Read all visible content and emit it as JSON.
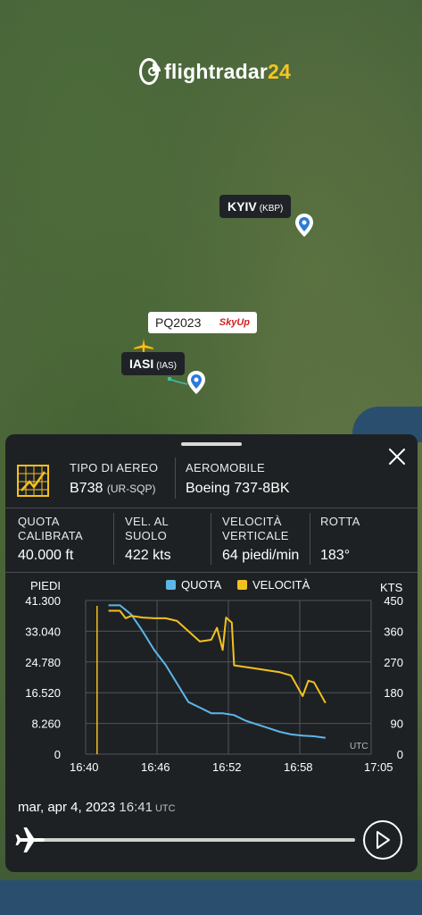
{
  "app": {
    "logo_text": "flightradar",
    "logo_num": "24"
  },
  "map": {
    "kyiv": {
      "name": "KYIV",
      "code": "(KBP)"
    },
    "iasi": {
      "name": "IASI",
      "code": "(IAS)"
    },
    "flight": {
      "callsign": "PQ2023",
      "airline_logo": "SkyUp"
    }
  },
  "panel": {
    "aircraft_type": {
      "label": "TIPO DI AEREO",
      "value": "B738",
      "reg": "(UR-SQP)"
    },
    "aircraft": {
      "label": "AEROMOBILE",
      "value": "Boeing 737-8BK"
    },
    "stats": [
      {
        "label_1": "QUOTA",
        "label_2": "CALIBRATA",
        "value": "40.000 ft"
      },
      {
        "label_1": "VEL. AL",
        "label_2": "SUOLO",
        "value": "422 kts"
      },
      {
        "label_1": "VELOCITÀ",
        "label_2": "VERTICALE",
        "value": "64 piedi/min"
      },
      {
        "label_1": "ROTTA",
        "label_2": "",
        "value": "183°"
      }
    ],
    "footer": {
      "date": "mar, apr 4, 2023",
      "time": "16:41",
      "tz": "UTC"
    }
  },
  "colors": {
    "altitude": "#5db6e8",
    "speed": "#f3c11e",
    "panel_bg": "#1e2124"
  },
  "chart_data": {
    "type": "line",
    "left_axis_label": "PIEDI",
    "right_axis_label": "KTS",
    "x_unit_label": "UTC",
    "x_ticks": [
      "16:40",
      "16:46",
      "16:52",
      "16:58",
      "17:05"
    ],
    "left_ticks": [
      "41.300",
      "33.040",
      "24.780",
      "16.520",
      "8.260",
      "0"
    ],
    "right_ticks": [
      "450",
      "360",
      "270",
      "180",
      "90",
      "0"
    ],
    "left_range": [
      0,
      41300
    ],
    "right_range": [
      0,
      450
    ],
    "legend": [
      {
        "name": "QUOTA",
        "color": "#5db6e8"
      },
      {
        "name": "VELOCITÀ",
        "color": "#f3c11e"
      }
    ],
    "series": [
      {
        "name": "QUOTA",
        "axis": "left",
        "points": [
          [
            "16:42",
            40000
          ],
          [
            "16:43",
            40000
          ],
          [
            "16:44",
            37500
          ],
          [
            "16:45",
            33000
          ],
          [
            "16:46",
            28000
          ],
          [
            "16:47",
            24000
          ],
          [
            "16:48",
            19000
          ],
          [
            "16:49",
            14000
          ],
          [
            "16:50",
            12500
          ],
          [
            "16:51",
            11000
          ],
          [
            "16:52",
            11000
          ],
          [
            "16:53",
            10500
          ],
          [
            "16:54",
            9000
          ],
          [
            "16:55",
            8000
          ],
          [
            "16:56",
            7000
          ],
          [
            "16:57",
            6000
          ],
          [
            "16:58",
            5300
          ],
          [
            "16:59",
            5000
          ],
          [
            "17:00",
            4800
          ],
          [
            "17:01",
            4400
          ]
        ]
      },
      {
        "name": "VELOCITÀ",
        "axis": "right",
        "points": [
          [
            "16:42",
            420
          ],
          [
            "16:43",
            420
          ],
          [
            "16:43.5",
            398
          ],
          [
            "16:44",
            405
          ],
          [
            "16:45",
            400
          ],
          [
            "16:46",
            398
          ],
          [
            "16:47",
            398
          ],
          [
            "16:48",
            390
          ],
          [
            "16:49",
            360
          ],
          [
            "16:50",
            330
          ],
          [
            "16:51",
            335
          ],
          [
            "16:51.5",
            370
          ],
          [
            "16:52",
            305
          ],
          [
            "16:52.3",
            400
          ],
          [
            "16:52.8",
            385
          ],
          [
            "16:53",
            260
          ],
          [
            "16:54",
            255
          ],
          [
            "16:55",
            250
          ],
          [
            "16:56",
            245
          ],
          [
            "16:57",
            240
          ],
          [
            "16:58",
            230
          ],
          [
            "16:59",
            170
          ],
          [
            "16:59.5",
            215
          ],
          [
            "17:00",
            210
          ],
          [
            "17:01",
            150
          ]
        ]
      }
    ],
    "marker_x": "16:41"
  }
}
